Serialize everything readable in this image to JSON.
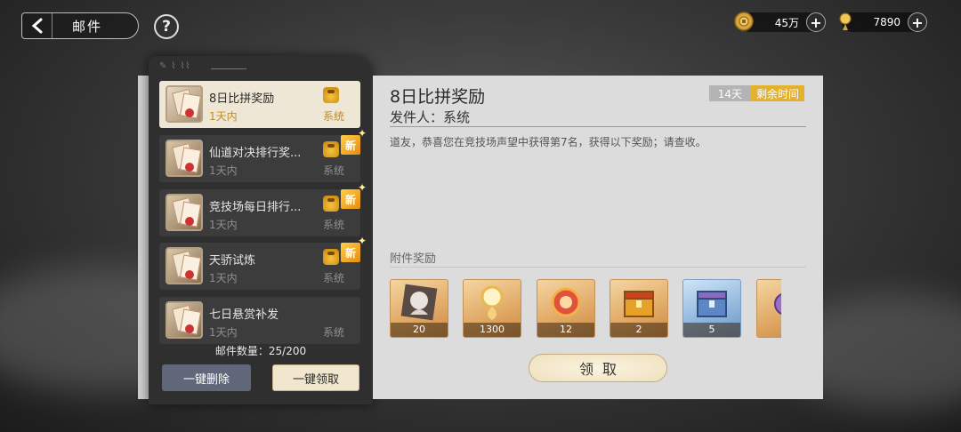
{
  "header": {
    "title": "邮件",
    "help_label": "?",
    "currencies": [
      {
        "icon": "coin-icon",
        "value": "45万"
      },
      {
        "icon": "spirit-stone-icon",
        "value": "7890"
      }
    ],
    "plus_label": "+"
  },
  "mail_list": {
    "items": [
      {
        "title": "8日比拼奖励",
        "time": "1天内",
        "sender": "系统",
        "is_new": false,
        "selected": true
      },
      {
        "title": "仙道对决排行奖...",
        "time": "1天内",
        "sender": "系统",
        "is_new": true,
        "selected": false
      },
      {
        "title": "竞技场每日排行...",
        "time": "1天内",
        "sender": "系统",
        "is_new": true,
        "selected": false
      },
      {
        "title": "天骄试炼",
        "time": "1天内",
        "sender": "系统",
        "is_new": true,
        "selected": false
      },
      {
        "title": "七日悬赏补发",
        "time": "1天内",
        "sender": "系统",
        "is_new": false,
        "selected": false
      }
    ],
    "new_label": "新",
    "count_text": "邮件数量：25/200",
    "delete_all_label": "一键删除",
    "collect_all_label": "一键领取"
  },
  "detail": {
    "title": "8日比拼奖励",
    "days": "14天",
    "remaining_label": "剩余时间",
    "sender": "发件人：系统",
    "body": "道友，恭喜您在竞技场声望中获得第7名，获得以下奖励；请查收。",
    "attachments_label": "附件奖励",
    "rewards": [
      {
        "icon": "portrait-card-icon",
        "count": "20"
      },
      {
        "icon": "spirit-essence-icon",
        "count": "1300"
      },
      {
        "icon": "fire-orb-icon",
        "count": "12"
      },
      {
        "icon": "gold-chest-icon",
        "count": "2"
      },
      {
        "icon": "blue-chest-icon",
        "count": "5"
      },
      {
        "icon": "purple-item-icon",
        "count": ""
      }
    ],
    "claim_label": "领取"
  }
}
